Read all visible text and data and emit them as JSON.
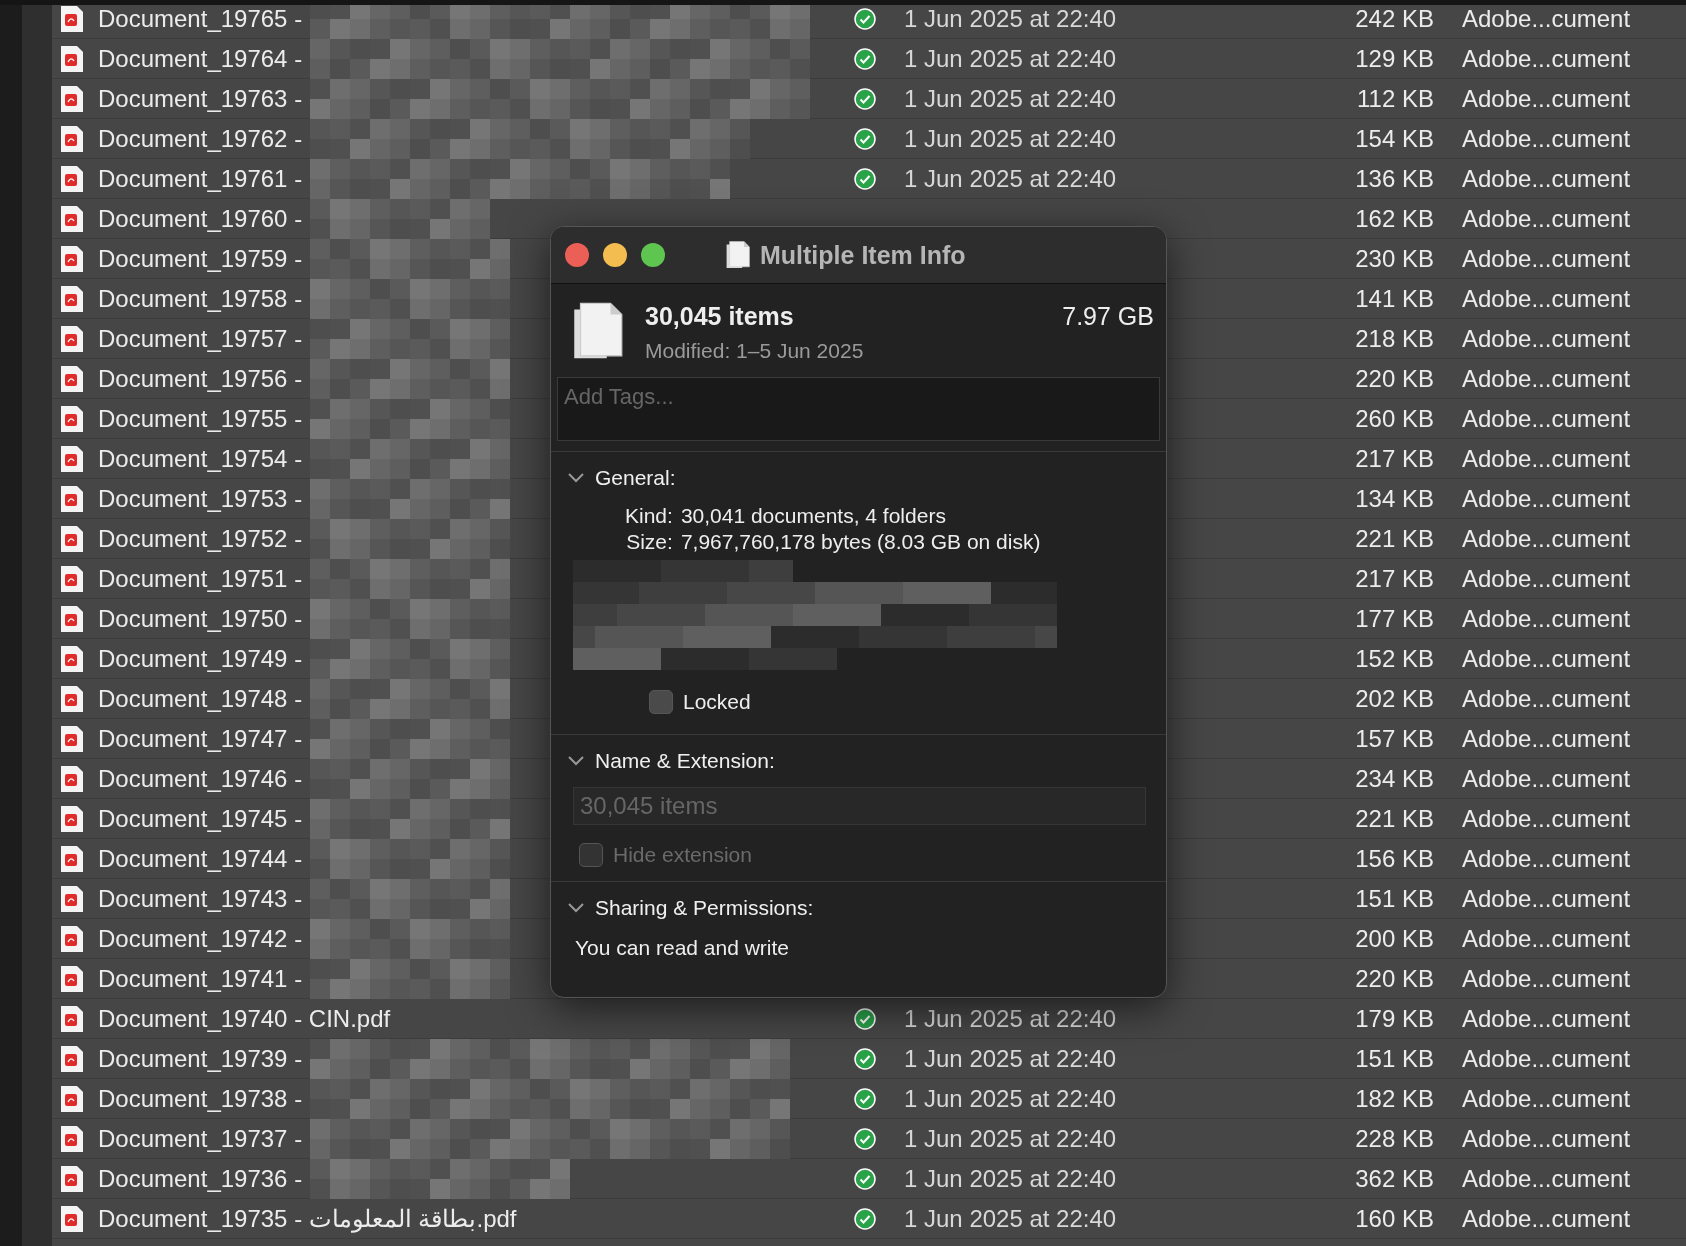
{
  "files": [
    {
      "name": "Document_19765 -",
      "redacted": true,
      "synced": true,
      "date": "1 Jun 2025 at 22:40",
      "size": "242 KB",
      "kind": "Adobe...cument"
    },
    {
      "name": "Document_19764 -",
      "redacted": true,
      "synced": true,
      "date": "1 Jun 2025 at 22:40",
      "size": "129 KB",
      "kind": "Adobe...cument"
    },
    {
      "name": "Document_19763 -",
      "redacted": true,
      "synced": true,
      "date": "1 Jun 2025 at 22:40",
      "size": "112 KB",
      "kind": "Adobe...cument"
    },
    {
      "name": "Document_19762 -",
      "redacted": true,
      "synced": true,
      "date": "1 Jun 2025 at 22:40",
      "size": "154 KB",
      "kind": "Adobe...cument"
    },
    {
      "name": "Document_19761 -",
      "redacted": true,
      "synced": true,
      "date": "1 Jun 2025 at 22:40",
      "size": "136 KB",
      "kind": "Adobe...cument"
    },
    {
      "name": "Document_19760 -",
      "redacted": true,
      "size": "162 KB",
      "kind": "Adobe...cument"
    },
    {
      "name": "Document_19759 -",
      "redacted": true,
      "size": "230 KB",
      "kind": "Adobe...cument"
    },
    {
      "name": "Document_19758 -",
      "redacted": true,
      "size": "141 KB",
      "kind": "Adobe...cument"
    },
    {
      "name": "Document_19757 -",
      "redacted": true,
      "size": "218 KB",
      "kind": "Adobe...cument"
    },
    {
      "name": "Document_19756 -",
      "redacted": true,
      "size": "220 KB",
      "kind": "Adobe...cument"
    },
    {
      "name": "Document_19755 -",
      "redacted": true,
      "size": "260 KB",
      "kind": "Adobe...cument"
    },
    {
      "name": "Document_19754 -",
      "redacted": true,
      "size": "217 KB",
      "kind": "Adobe...cument"
    },
    {
      "name": "Document_19753 -",
      "redacted": true,
      "size": "134 KB",
      "kind": "Adobe...cument"
    },
    {
      "name": "Document_19752 -",
      "redacted": true,
      "size": "221 KB",
      "kind": "Adobe...cument"
    },
    {
      "name": "Document_19751 -",
      "redacted": true,
      "size": "217 KB",
      "kind": "Adobe...cument"
    },
    {
      "name": "Document_19750 -",
      "redacted": true,
      "size": "177 KB",
      "kind": "Adobe...cument"
    },
    {
      "name": "Document_19749 -",
      "redacted": true,
      "size": "152 KB",
      "kind": "Adobe...cument"
    },
    {
      "name": "Document_19748 -",
      "redacted": true,
      "size": "202 KB",
      "kind": "Adobe...cument"
    },
    {
      "name": "Document_19747 -",
      "redacted": true,
      "size": "157 KB",
      "kind": "Adobe...cument"
    },
    {
      "name": "Document_19746 -",
      "redacted": true,
      "size": "234 KB",
      "kind": "Adobe...cument"
    },
    {
      "name": "Document_19745 -",
      "redacted": true,
      "size": "221 KB",
      "kind": "Adobe...cument"
    },
    {
      "name": "Document_19744 -",
      "redacted": true,
      "size": "156 KB",
      "kind": "Adobe...cument"
    },
    {
      "name": "Document_19743 -",
      "redacted": true,
      "size": "151 KB",
      "kind": "Adobe...cument"
    },
    {
      "name": "Document_19742 -",
      "redacted": true,
      "size": "200 KB",
      "kind": "Adobe...cument"
    },
    {
      "name": "Document_19741 -",
      "redacted": true,
      "size": "220 KB",
      "kind": "Adobe...cument"
    },
    {
      "name": "Document_19740 - CIN.pdf",
      "redacted": false,
      "synced": true,
      "date": "1 Jun 2025 at 22:40",
      "size": "179 KB",
      "kind": "Adobe...cument"
    },
    {
      "name": "Document_19739 -",
      "redacted": true,
      "synced": true,
      "date": "1 Jun 2025 at 22:40",
      "size": "151 KB",
      "kind": "Adobe...cument"
    },
    {
      "name": "Document_19738 -",
      "redacted": true,
      "synced": true,
      "date": "1 Jun 2025 at 22:40",
      "size": "182 KB",
      "kind": "Adobe...cument"
    },
    {
      "name": "Document_19737 -",
      "redacted": true,
      "synced": true,
      "date": "1 Jun 2025 at 22:40",
      "size": "228 KB",
      "kind": "Adobe...cument"
    },
    {
      "name": "Document_19736 -",
      "redacted": true,
      "synced": true,
      "date": "1 Jun 2025 at 22:40",
      "size": "362 KB",
      "kind": "Adobe...cument"
    },
    {
      "name": "Document_19735 - بطاقة المعلومات.pdf",
      "redacted": false,
      "synced": true,
      "date": "1 Jun 2025 at 22:40",
      "size": "160 KB",
      "kind": "Adobe...cument"
    }
  ],
  "info_window": {
    "title": "Multiple Item Info",
    "summary": {
      "count": "30,045 items",
      "size": "7.97 GB",
      "modified": "Modified: 1–5 Jun 2025"
    },
    "tags": {
      "placeholder": "Add Tags..."
    },
    "general": {
      "title": "General:",
      "expanded": true,
      "kind_label": "Kind:",
      "kind": "30,041 documents, 4 folders",
      "size_label": "Size:",
      "size": "7,967,760,178 bytes (8.03 GB on disk)",
      "locked": {
        "label": "Locked",
        "checked": false
      }
    },
    "name_extension": {
      "title": "Name & Extension:",
      "expanded": true,
      "field_value": "30,045 items",
      "hide_extension": {
        "label": "Hide extension",
        "checked": false,
        "disabled": true
      }
    },
    "sharing": {
      "title": "Sharing & Permissions:",
      "expanded": true,
      "text": "You can read and write"
    }
  }
}
